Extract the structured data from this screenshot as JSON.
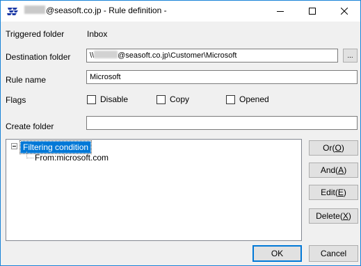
{
  "window": {
    "title": "@seasoft.co.jp - Rule definition -",
    "controls": {
      "minimize_icon": "minimize-icon",
      "maximize_icon": "maximize-icon",
      "close_icon": "close-icon"
    }
  },
  "form": {
    "triggered_folder": {
      "label": "Triggered folder",
      "value": "Inbox"
    },
    "destination_folder": {
      "label": "Destination folder",
      "prefix": "\\\\",
      "value": "@seasoft.co.jp\\Customer\\Microsoft",
      "browse_label": "..."
    },
    "rule_name": {
      "label": "Rule name",
      "value": "Microsoft"
    },
    "flags": {
      "label": "Flags",
      "options": [
        {
          "label": "Disable",
          "checked": false
        },
        {
          "label": "Copy",
          "checked": false
        },
        {
          "label": "Opened",
          "checked": false
        }
      ]
    },
    "create_folder": {
      "label": "Create folder",
      "value": ""
    }
  },
  "tree": {
    "root": "Filtering condition",
    "children": [
      "From:microsoft.com"
    ]
  },
  "side_buttons": {
    "or": {
      "pre": "Or(",
      "key": "O",
      "post": ")"
    },
    "and": {
      "pre": "And(",
      "key": "A",
      "post": ")"
    },
    "edit": {
      "pre": "Edit(",
      "key": "E",
      "post": ")"
    },
    "delete": {
      "pre": "Delete(",
      "key": "X",
      "post": ")"
    }
  },
  "footer": {
    "ok_label": "OK",
    "cancel_label": "Cancel"
  },
  "colors": {
    "accent": "#0078d7",
    "window_border": "#1883d7",
    "dialog_bg": "#f0f0f0"
  }
}
